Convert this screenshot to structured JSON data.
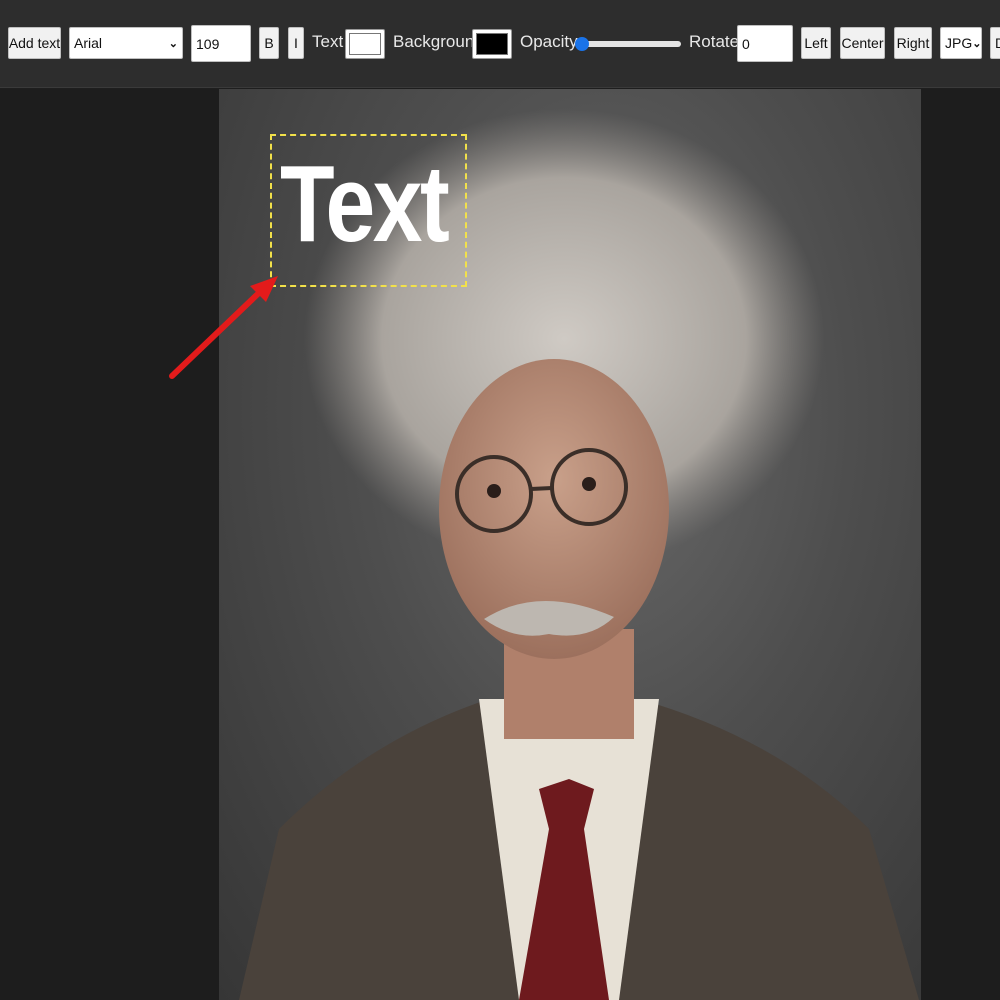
{
  "toolbar": {
    "add_text_label": "Add text",
    "font_family_value": "Arial",
    "font_size_value": "109",
    "bold_label": "B",
    "italic_label": "I",
    "text_color_label": "Text",
    "text_color": "#ffffff",
    "background_label": "Background",
    "background_color": "#000000",
    "opacity_label": "Opacity",
    "opacity_value": 0.0,
    "rotate_label": "Rotate",
    "rotate_value": "0",
    "align_left_label": "Left",
    "align_center_label": "Center",
    "align_right_label": "Right",
    "format_value": "JPG",
    "download_label": "D"
  },
  "canvas": {
    "overlay_text": "Text",
    "selection_color": "#f2e14a",
    "arrow_color": "#e31b1b"
  }
}
